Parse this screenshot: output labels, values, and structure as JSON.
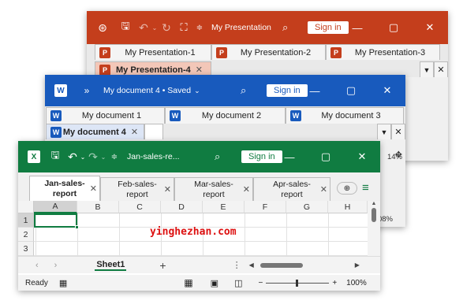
{
  "ppt": {
    "title": "My Presentation",
    "signin": "Sign in",
    "tabs": [
      "My Presentation-1",
      "My Presentation-2",
      "My Presentation-3"
    ],
    "active_tab": "My Presentation-4",
    "color": "#c43e1c"
  },
  "word": {
    "title": "My document 4 • Saved",
    "signin": "Sign in",
    "tabs": [
      "My document 1",
      "My document 2",
      "My document 3"
    ],
    "active_tab": "My document 4",
    "zoom": "14%",
    "color": "#185abd"
  },
  "excel": {
    "title": "Jan-sales-re...",
    "signin": "Sign in",
    "tabs": [
      {
        "line1": "Jan-sales-",
        "line2": "report"
      },
      {
        "line1": "Feb-sales-",
        "line2": "report"
      },
      {
        "line1": "Mar-sales-",
        "line2": "report"
      },
      {
        "line1": "Apr-sales-",
        "line2": "report"
      }
    ],
    "columns": [
      "A",
      "B",
      "C",
      "D",
      "E",
      "F",
      "G",
      "H"
    ],
    "rows": [
      "1",
      "2",
      "3"
    ],
    "sheet": "Sheet1",
    "status": "Ready",
    "zoom": "100%",
    "behind_zoom": "08%",
    "color": "#107c41"
  },
  "watermark": "yinghezhan.com"
}
